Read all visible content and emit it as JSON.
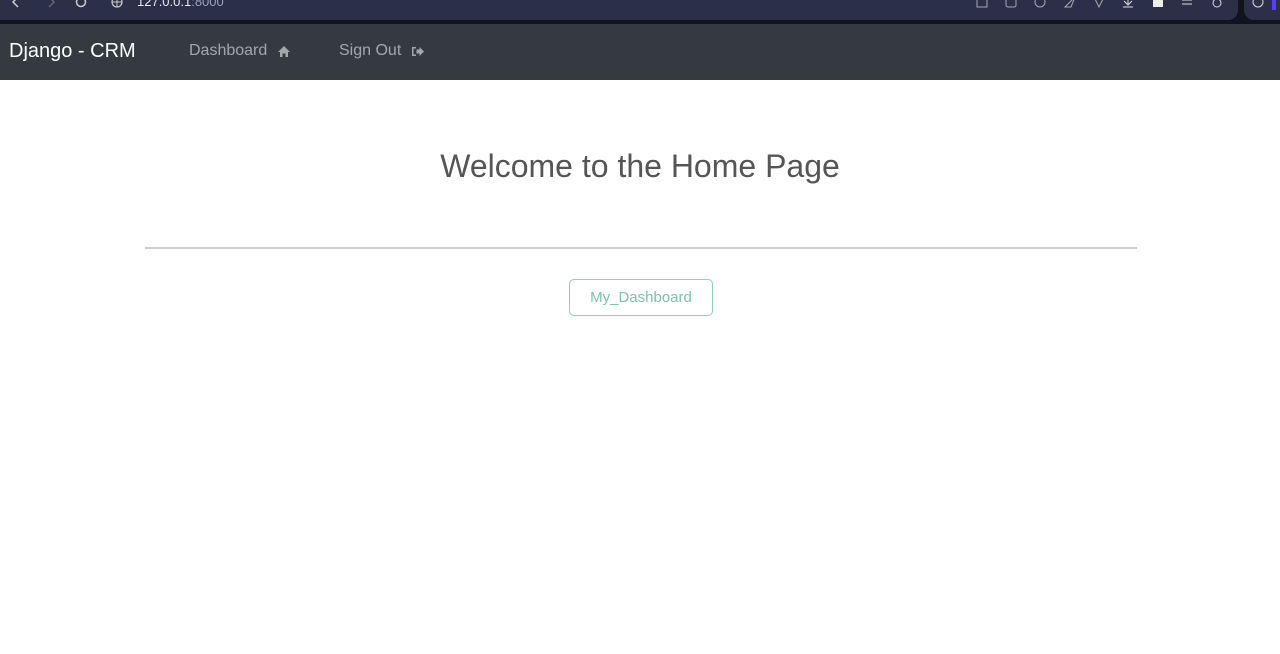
{
  "browser": {
    "url_host": "127.0.0.1",
    "url_port": ":8000"
  },
  "navbar": {
    "brand": "Django - CRM",
    "links": [
      {
        "label": "Dashboard",
        "icon": "home-icon"
      },
      {
        "label": "Sign Out",
        "icon": "sign-out-icon"
      }
    ]
  },
  "main": {
    "title": "Welcome to the Home Page",
    "dashboard_button": "My_Dashboard"
  },
  "colors": {
    "navbar_bg": "#343a40",
    "button_accent": "#7cc3a8"
  }
}
